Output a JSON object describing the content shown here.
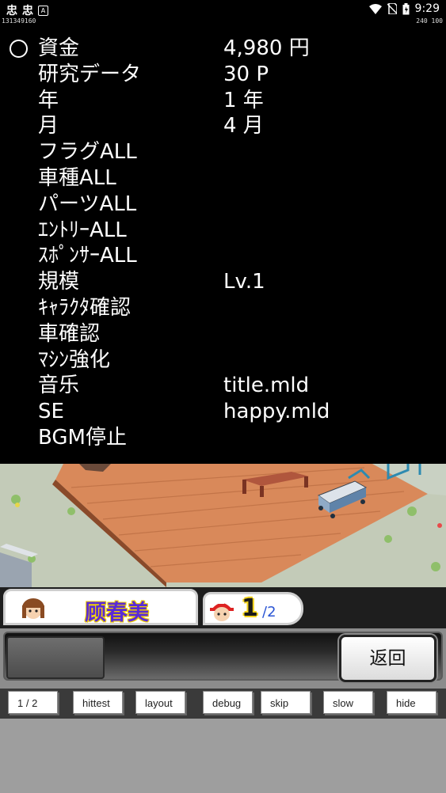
{
  "status_bar": {
    "left_glyphs": [
      "忠",
      "忠"
    ],
    "small_icon": "A",
    "sub_left": "131349160",
    "sub_right": "240  100",
    "time": "9:29",
    "icons": [
      "wifi-icon",
      "no-sim-icon",
      "battery-icon"
    ]
  },
  "menu": {
    "rows": [
      {
        "label": "資金",
        "value": "4,980 円"
      },
      {
        "label": "研究データ",
        "value": "30 P"
      },
      {
        "label": "年",
        "value": "1 年"
      },
      {
        "label": "月",
        "value": "4 月"
      },
      {
        "label": "フラグALL",
        "value": ""
      },
      {
        "label": "車種ALL",
        "value": ""
      },
      {
        "label": "パーツALL",
        "value": ""
      },
      {
        "label": "ｴﾝﾄﾘｰALL",
        "value": ""
      },
      {
        "label": "ｽﾎﾟﾝｻｰALL",
        "value": ""
      },
      {
        "label": "規模",
        "value": "Lv.1"
      },
      {
        "label": "ｷｬﾗｸﾀ確認",
        "value": ""
      },
      {
        "label": "車確認",
        "value": ""
      },
      {
        "label": "ﾏｼﾝ強化",
        "value": ""
      },
      {
        "label": "音乐",
        "value": "title.mld"
      },
      {
        "label": "SE",
        "value": "happy.mld"
      },
      {
        "label": "BGM停止",
        "value": ""
      }
    ]
  },
  "panel": {
    "character_name": "顾春美",
    "page_current": "1",
    "page_total": "/2",
    "back_button": "返回",
    "debug_buttons": [
      "1 / 2",
      "hittest",
      "layout",
      "debug",
      "skip",
      "slow",
      "hide"
    ]
  }
}
